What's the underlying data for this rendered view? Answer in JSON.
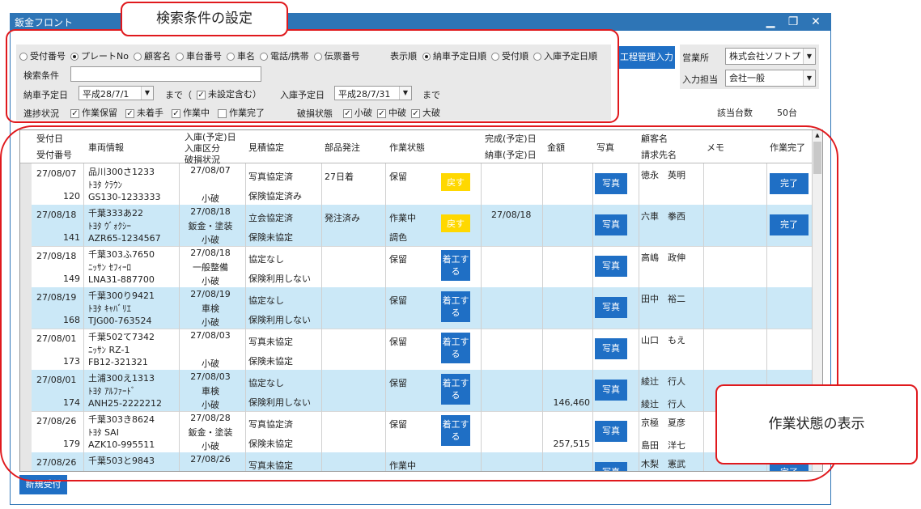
{
  "window": {
    "title": "鈑金フロント",
    "minimize": "▁",
    "restore": "❐",
    "close": "✕"
  },
  "callouts": {
    "search": "検索条件の設定",
    "status": "作業状態の表示"
  },
  "search": {
    "search_keys": [
      "受付番号",
      "プレートNo",
      "顧客名",
      "車台番号",
      "車名",
      "電話/携帯",
      "伝票番号"
    ],
    "selected_key": "プレートNo",
    "order_label": "表示順",
    "order_options": [
      "納車予定日順",
      "受付順",
      "入庫予定日順"
    ],
    "selected_order": "納車予定日順",
    "condition_label": "検索条件",
    "condition_value": "",
    "delivery_label": "納車予定日",
    "delivery_date": "平成28/7/1",
    "until1": "まで（",
    "unset_label": "未設定含む",
    "close_paren": "）",
    "arrival_label": "入庫予定日",
    "arrival_date": "平成28/7/31",
    "until2": "まで",
    "progress_label": "進捗状況",
    "progress_options": [
      {
        "label": "作業保留",
        "checked": true
      },
      {
        "label": "未着手",
        "checked": true
      },
      {
        "label": "作業中",
        "checked": true
      },
      {
        "label": "作業完了",
        "checked": false
      }
    ],
    "damage_label": "破損状態",
    "damage_options": [
      {
        "label": "小破",
        "checked": true
      },
      {
        "label": "中破",
        "checked": true
      },
      {
        "label": "大破",
        "checked": true
      }
    ]
  },
  "right_panel": {
    "process_button": "工程管理入力",
    "office_label": "営業所",
    "office_value": "株式会社ソフトプ",
    "staff_label": "入力担当",
    "staff_value": "会社一般",
    "count_label": "該当台数",
    "count_value": "50台"
  },
  "grid": {
    "headers": {
      "reception_date": "受付日",
      "reception_no": "受付番号",
      "vehicle": "車両情報",
      "arrival": "入庫(予定)日",
      "arrival_type": "入庫区分",
      "damage": "破損状況",
      "estimate": "見積協定",
      "parts": "部品発注",
      "status": "作業状態",
      "completion": "完成(予定)日",
      "delivery": "納車(予定)日",
      "amount": "金額",
      "photo": "写真",
      "customer": "顧客名",
      "billing": "請求先名",
      "memo": "メモ",
      "done": "作業完了"
    },
    "rows": [
      {
        "date": "27/08/07",
        "no": "120",
        "plate": "品川300さ1233",
        "car": "ﾄﾖﾀ ｸﾗｳﾝ",
        "model": "GS130-1233333",
        "arrival": "27/08/07",
        "atype": "",
        "damage": "小破",
        "est1": "写真協定済",
        "est2": "保険協定済み",
        "parts": "27日着",
        "st1": "保留",
        "st2": "",
        "action": "戻す",
        "action_type": "yellow",
        "completion": "",
        "amount": "",
        "photo": "写真",
        "cust1": "徳永　英明",
        "cust2": "",
        "done": "完了"
      },
      {
        "date": "27/08/18",
        "no": "141",
        "plate": "千葉333あ22",
        "car": "ﾄﾖﾀ ｳﾞｫｸｼｰ",
        "model": "AZR65-1234567",
        "arrival": "27/08/18",
        "atype": "鈑金・塗装",
        "damage": "小破",
        "est1": "立会協定済",
        "est2": "保険未協定",
        "parts": "発注済み",
        "st1": "作業中",
        "st2": "調色",
        "action": "戻す",
        "action_type": "yellow",
        "completion": "27/08/18",
        "amount": "",
        "photo": "写真",
        "cust1": "六車　拳西",
        "cust2": "",
        "done": "完了"
      },
      {
        "date": "27/08/18",
        "no": "149",
        "plate": "千葉303ふ7650",
        "car": "ﾆｯｻﾝ ｾﾌｨｰﾛ",
        "model": "LNA31-887700",
        "arrival": "27/08/18",
        "atype": "一般整備",
        "damage": "小破",
        "est1": "協定なし",
        "est2": "保険利用しない",
        "parts": "",
        "st1": "保留",
        "st2": "",
        "action": "着工する",
        "action_type": "blue",
        "completion": "",
        "amount": "",
        "photo": "写真",
        "cust1": "高嶋　政伸",
        "cust2": "",
        "done": ""
      },
      {
        "date": "27/08/19",
        "no": "168",
        "plate": "千葉300り9421",
        "car": "ﾄﾖﾀ ｷｬﾊﾞﾘｴ",
        "model": "TJG00-763524",
        "arrival": "27/08/19",
        "atype": "車検",
        "damage": "小破",
        "est1": "協定なし",
        "est2": "保険利用しない",
        "parts": "",
        "st1": "保留",
        "st2": "",
        "action": "着工する",
        "action_type": "blue",
        "completion": "",
        "amount": "",
        "photo": "写真",
        "cust1": "田中　裕二",
        "cust2": "",
        "done": ""
      },
      {
        "date": "27/08/01",
        "no": "173",
        "plate": "千葉502て7342",
        "car": "ﾆｯｻﾝ RZ-1",
        "model": "FB12-321321",
        "arrival": "27/08/03",
        "atype": "",
        "damage": "小破",
        "est1": "写真未協定",
        "est2": "保険未協定",
        "parts": "",
        "st1": "保留",
        "st2": "",
        "action": "着工する",
        "action_type": "blue",
        "completion": "",
        "amount": "",
        "photo": "写真",
        "cust1": "山口　もえ",
        "cust2": "",
        "done": ""
      },
      {
        "date": "27/08/01",
        "no": "174",
        "plate": "土浦300え1313",
        "car": "ﾄﾖﾀ ｱﾙﾌｧｰﾄﾞ",
        "model": "ANH25-2222212",
        "arrival": "27/08/03",
        "atype": "車検",
        "damage": "小破",
        "est1": "協定なし",
        "est2": "保険利用しない",
        "parts": "",
        "st1": "保留",
        "st2": "",
        "action": "着工する",
        "action_type": "blue",
        "completion": "",
        "amount": "146,460",
        "photo": "写真",
        "cust1": "綾辻　行人",
        "cust2": "綾辻　行人",
        "done": ""
      },
      {
        "date": "27/08/26",
        "no": "179",
        "plate": "千葉303き8624",
        "car": "ﾄﾖﾀ SAI",
        "model": "AZK10-995511",
        "arrival": "27/08/28",
        "atype": "鈑金・塗装",
        "damage": "小破",
        "est1": "写真協定済",
        "est2": "保険未協定",
        "parts": "",
        "st1": "保留",
        "st2": "",
        "action": "着工する",
        "action_type": "blue",
        "completion": "",
        "amount": "257,515",
        "photo": "写真",
        "cust1": "京極　夏彦",
        "cust2": "島田　洋七",
        "done": ""
      },
      {
        "date": "27/08/26",
        "no": "",
        "plate": "千葉503と9843",
        "car": "",
        "model": "",
        "arrival": "27/08/26",
        "atype": "",
        "damage": "",
        "est1": "写真未協定",
        "est2": "",
        "parts": "",
        "st1": "作業中",
        "st2": "",
        "action": "",
        "action_type": "yellow",
        "completion": "",
        "amount": "",
        "photo": "写真",
        "cust1": "木梨　憲武",
        "cust2": "",
        "done": "完了"
      }
    ]
  },
  "footer": {
    "new_button": "新規受付"
  },
  "colors": {
    "accent": "#2e75b6",
    "button_blue": "#1f6fc5",
    "button_yellow": "#ffd800",
    "row_alt": "#cbe8f7",
    "callout_red": "#e0191d"
  }
}
